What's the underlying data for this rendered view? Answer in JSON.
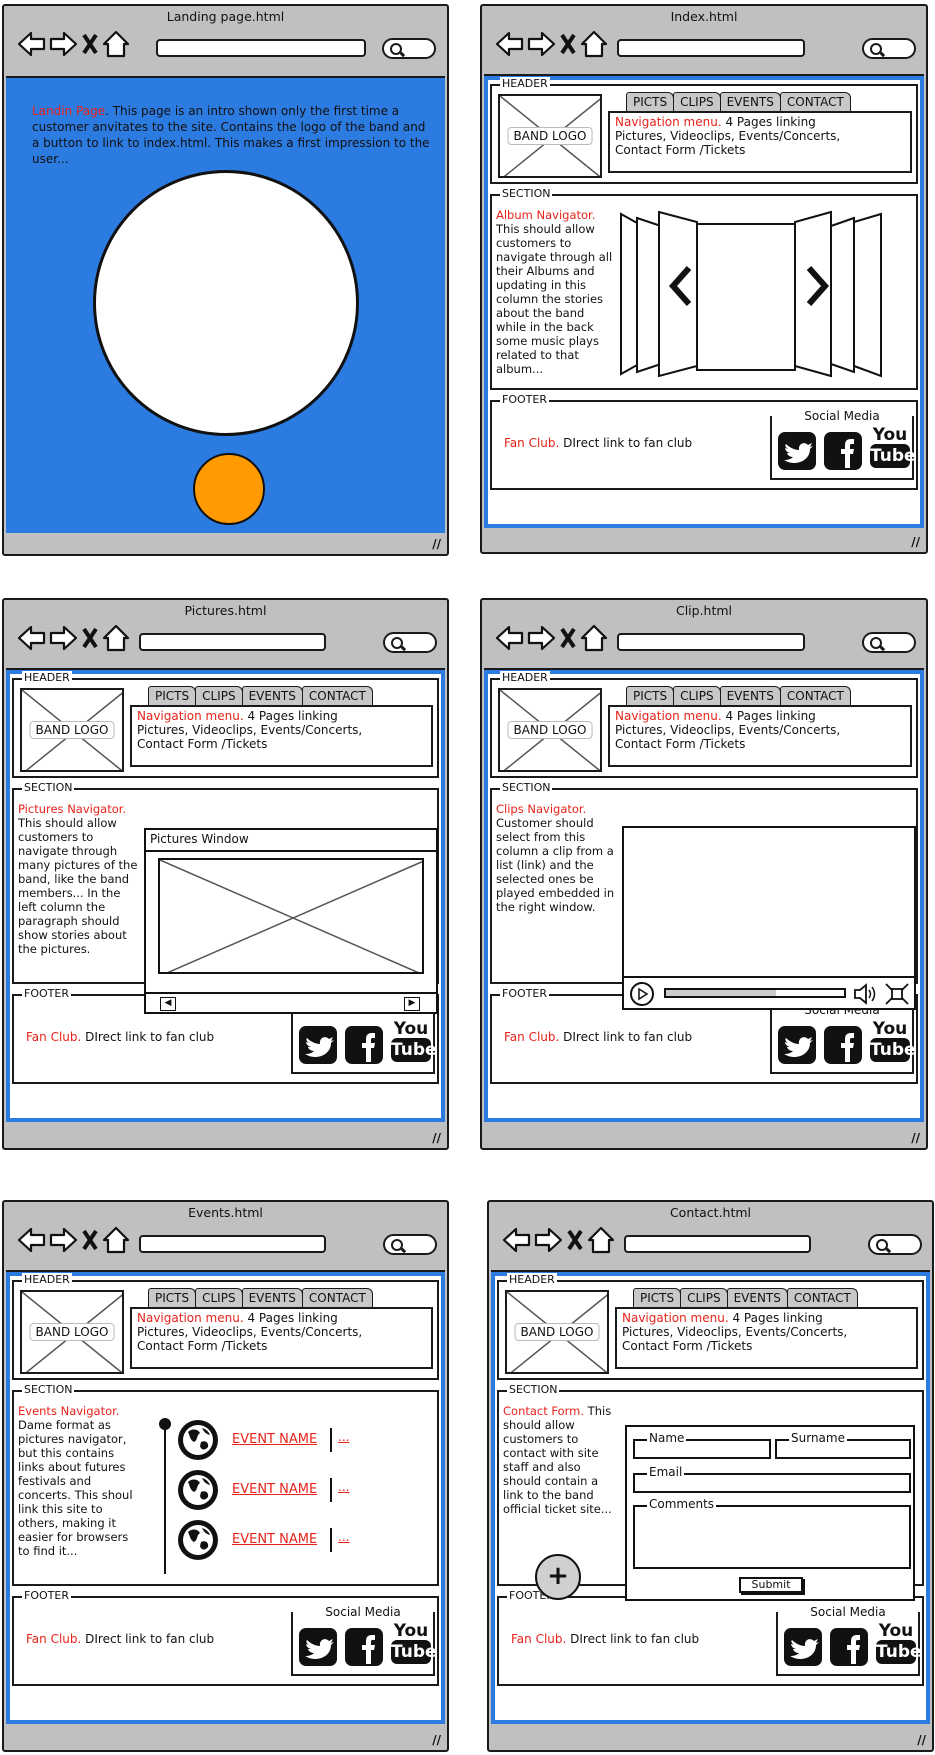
{
  "colors": {
    "blue": "#2c7be0",
    "red": "#e8231a",
    "orange": "#ff9a00",
    "chrome": "#c0c0c0"
  },
  "header_label": "HEADER",
  "section_label": "SECTION",
  "footer_label": "FOOTER",
  "band_logo": "BAND LOGO",
  "tabs": [
    "PICTS",
    "CLIPS",
    "EVENTS",
    "CONTACT"
  ],
  "nav_title": "Navigation menu.",
  "nav_text1": " 4 Pages linking",
  "nav_text2": "Pictures, Videoclips, Events/Concerts,",
  "nav_text3": "Contact Form /Tickets",
  "fan_title": "Fan Club.",
  "fan_text": " DIrect link to fan club",
  "social_label": "Social Media",
  "social_icons": [
    "twitter-icon",
    "facebook-icon",
    "youtube-icon"
  ],
  "youtube_you": "You",
  "youtube_tube": "Tube",
  "landing": {
    "title": "Landing page.html",
    "desc_title": "Landin Page",
    "desc_text": ". This page is an intro shown only the first time a customer anvitates to the site. Contains the logo of the band and a button to link to index.html. This makes a first impression to the user..."
  },
  "index": {
    "title": "Index.html",
    "desc_title": "Album Navigator.",
    "desc_text": "This should allow customers to navigate through all their Albums and updating in this column the stories about the band while in the back some music plays related to that album..."
  },
  "pictures": {
    "title": "Pictures.html",
    "desc_title": "Pictures Navigator.",
    "desc_text": "This should allow customers to navigate through many pictures of the band, like the band members... In the left column the paragraph should show stories about the pictures.",
    "window_title": "Pictures Window"
  },
  "clip": {
    "title": "Clip.html",
    "desc_title": "Clips Navigator.",
    "desc_text": "Customer should select from this column a clip from a list (link) and the selected ones be played embedded in the right window.",
    "progress": 0.62
  },
  "events": {
    "title": "Events.html",
    "desc_title": "Events Navigator.",
    "desc_text": "Dame format as pictures navigator, but this contains links about futures festivals and concerts. This shoul link this site to others, making it easier for browsers to find it...",
    "items": [
      {
        "name": "EVENT NAME",
        "more": "..."
      },
      {
        "name": "EVENT NAME",
        "more": "..."
      },
      {
        "name": "EVENT NAME",
        "more": "..."
      }
    ]
  },
  "contact": {
    "title": "Contact.html",
    "desc_title": "Contact Form.",
    "desc_text": " This should allow customers to contact with site staff and also should contain a link to the band official ticket site...",
    "name_label": "Name",
    "surname_label": "Surname",
    "email_label": "Email",
    "comments_label": "Comments",
    "submit": "Submit",
    "plus": "+"
  }
}
